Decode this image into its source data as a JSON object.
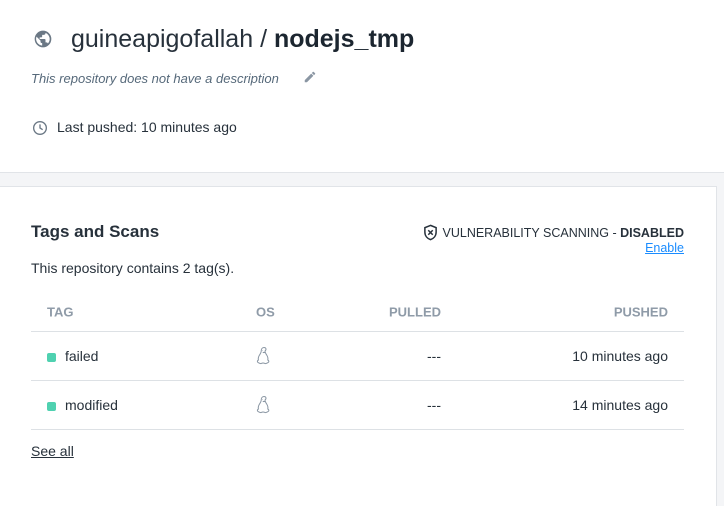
{
  "header": {
    "namespace": "guineapigofallah",
    "separator": "/",
    "repo": "nodejs_tmp",
    "description": "This repository does not have a description",
    "last_pushed": "Last pushed: 10 minutes ago"
  },
  "tags": {
    "title": "Tags and Scans",
    "summary": "This repository contains 2 tag(s).",
    "vuln_label": "VULNERABILITY SCANNING - ",
    "vuln_status": "DISABLED",
    "enable_label": "Enable",
    "columns": [
      "TAG",
      "OS",
      "PULLED",
      "PUSHED"
    ],
    "rows": [
      {
        "tag": "failed",
        "os": "linux",
        "pulled": "---",
        "pushed": "10 minutes ago"
      },
      {
        "tag": "modified",
        "os": "linux",
        "pulled": "---",
        "pushed": "14 minutes ago"
      }
    ],
    "see_all": "See all",
    "status_color": "#4fd1b0"
  }
}
